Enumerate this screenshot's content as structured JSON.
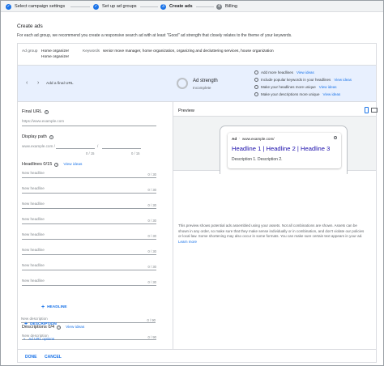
{
  "stepper": {
    "steps": [
      {
        "num": "✓",
        "label": "Select campaign settings",
        "state": "done"
      },
      {
        "num": "✓",
        "label": "Set up ad groups",
        "state": "done"
      },
      {
        "num": "3",
        "label": "Create ads",
        "state": "current"
      },
      {
        "num": "4",
        "label": "Billing",
        "state": "todo"
      }
    ]
  },
  "page": {
    "title": "Create ads",
    "description": "For each ad group, we recommend you create a responsive search ad with at least \"Good\" ad strength that closely relates to the theme of your keywords."
  },
  "ad_group": {
    "label": "Ad group",
    "values": [
      "Home organizer",
      "Home organizer"
    ],
    "keywords_label": "Keywords",
    "keywords_value": "senior move manager, home organization, organizing and decluttering services, house organization"
  },
  "band": {
    "add_final_url": "Add a final URL",
    "strength_title": "Ad strength",
    "strength_status": "Incomplete",
    "suggestions": [
      {
        "text": "Add more headlines",
        "link": "View ideas"
      },
      {
        "text": "Include popular keywords in your headlines",
        "link": "View ideas"
      },
      {
        "text": "Make your headlines more unique",
        "link": "View ideas"
      },
      {
        "text": "Make your descriptions more unique",
        "link": "View ideas"
      }
    ]
  },
  "form": {
    "final_url": {
      "title": "Final URL",
      "placeholder": "https://www.example.com"
    },
    "display_path": {
      "title": "Display path",
      "prefix": "www.example.com /",
      "separator": "/",
      "counts": [
        "0 / 15",
        "0 / 15"
      ]
    },
    "headlines": {
      "title": "Headlines 0/15",
      "view_ideas": "View ideas",
      "placeholder": "New headline",
      "count": "0 / 30",
      "add_label": "HEADLINE"
    },
    "descriptions": {
      "title": "Descriptions 0/4",
      "view_ideas": "View ideas",
      "placeholder": "New description",
      "count": "0 / 90",
      "add_label": "DESCRIPTION"
    },
    "ad_url_options": "Ad URL options"
  },
  "preview": {
    "title": "Preview",
    "ad_badge": "Ad",
    "ad_url": "www.example.com/",
    "headline": "Headline 1 | Headline 2 | Headline 3",
    "description": "Description 1. Description 2.",
    "note": "This preview shows potential ads assembled using your assets. Not all combinations are shown. Assets can be shown in any order, so make sure that they make sense individually or in combination, and don't violate our policies or local law. Some shortening may also occur in some formats. You can make sure certain text appears in your ad.",
    "learn_more": "Learn more"
  },
  "footer": {
    "done": "DONE",
    "cancel": "CANCEL"
  },
  "colors": {
    "accent": "#1a73e8",
    "band": "#e8f0fe",
    "ad_headline": "#1a0dab"
  }
}
